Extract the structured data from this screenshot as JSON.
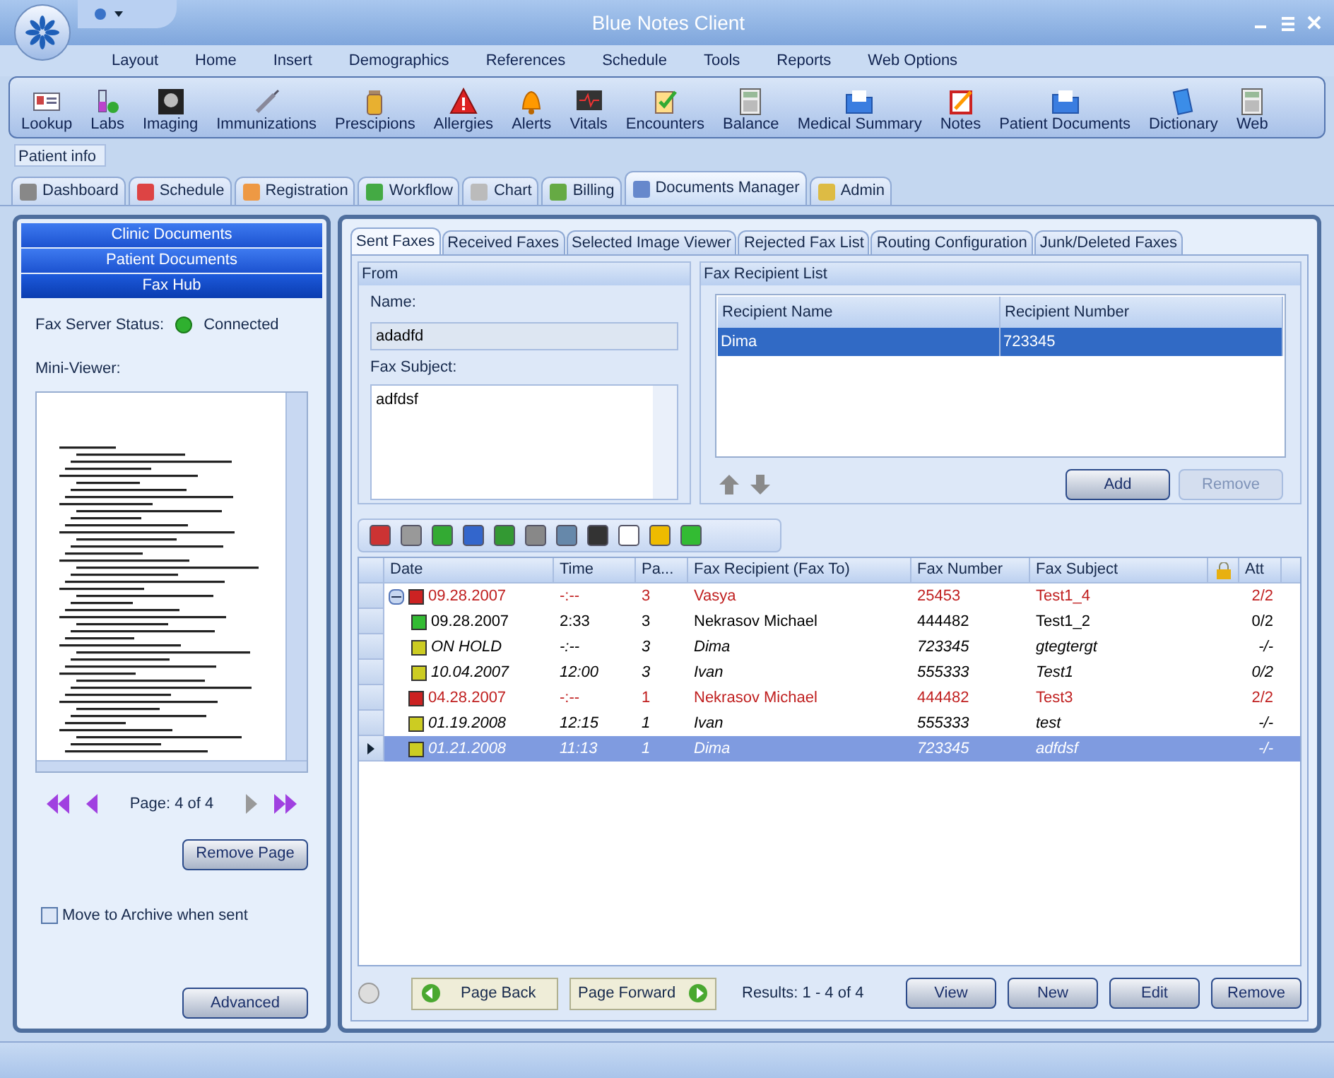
{
  "window": {
    "title": "Blue Notes Client"
  },
  "menu": [
    "Layout",
    "Home",
    "Insert",
    "Demographics",
    "References",
    "Schedule",
    "Tools",
    "Reports",
    "Web Options"
  ],
  "toolbar": [
    "Lookup",
    "Labs",
    "Imaging",
    "Immunizations",
    "Prescipions",
    "Allergies",
    "Alerts",
    "Vitals",
    "Encounters",
    "Balance",
    "Medical Summary",
    "Notes",
    "Patient Documents",
    "Dictionary",
    "Web"
  ],
  "patient_info": "Patient info",
  "main_tabs": [
    {
      "label": "Dashboard",
      "selected": false
    },
    {
      "label": "Schedule",
      "selected": false
    },
    {
      "label": "Registration",
      "selected": false
    },
    {
      "label": "Workflow",
      "selected": false
    },
    {
      "label": "Chart",
      "selected": false
    },
    {
      "label": "Billing",
      "selected": false
    },
    {
      "label": "Documents Manager",
      "selected": true
    },
    {
      "label": "Admin",
      "selected": false
    }
  ],
  "left_panel": {
    "sections": [
      {
        "label": "Clinic Documents",
        "selected": false
      },
      {
        "label": "Patient Documents",
        "selected": false
      },
      {
        "label": "Fax Hub",
        "selected": true
      }
    ],
    "fax_server_label": "Fax Server Status:",
    "fax_server_connected": true,
    "fax_server_status": "Connected",
    "mini_viewer_label": "Mini-Viewer:",
    "page_indicator": "Page: 4 of 4",
    "remove_page": "Remove Page",
    "archive": {
      "label": "Move to Archive when sent",
      "checked": false
    },
    "advanced": "Advanced"
  },
  "fax_tabs": [
    {
      "label": "Sent Faxes",
      "selected": true
    },
    {
      "label": "Received Faxes",
      "selected": false
    },
    {
      "label": "Selected Image Viewer",
      "selected": false
    },
    {
      "label": "Rejected Fax List",
      "selected": false
    },
    {
      "label": "Routing Configuration",
      "selected": false
    },
    {
      "label": "Junk/Deleted Faxes",
      "selected": false
    }
  ],
  "from": {
    "title": "From",
    "name_label": "Name:",
    "name_value": "adadfd",
    "subject_label": "Fax Subject:",
    "subject_value": "adfdsf"
  },
  "recipients": {
    "title": "Fax Recipient List",
    "columns": [
      "Recipient Name",
      "Recipient Number"
    ],
    "rows": [
      {
        "cells": [
          "Dima",
          "723345"
        ],
        "selected": true
      }
    ],
    "add": {
      "label": "Add",
      "disabled": false
    },
    "remove": {
      "label": "Remove",
      "disabled": true
    }
  },
  "grid": {
    "columns": [
      "Date",
      "Time",
      "Pa...",
      "Fax Recipient (Fax To)",
      "Fax Number",
      "Fax Subject",
      "",
      "Att"
    ],
    "rows": [
      {
        "cells": [
          "09.28.2007",
          "-:--",
          "3",
          "Vasya",
          "25453",
          "Test1_4",
          "2/2"
        ],
        "color": "#cc2222",
        "kind": "failed",
        "selected": false,
        "expanded": true,
        "children": [
          {
            "cells": [
              "09.28.2007",
              "2:33",
              "3",
              "Nekrasov Michael",
              "444482",
              "Test1_2",
              "0/2"
            ],
            "color": "#33bb33",
            "kind": "sent",
            "selected": false
          },
          {
            "cells": [
              "ON HOLD",
              "-:--",
              "3",
              "Dima",
              "723345",
              "gtegtergt",
              "-/-"
            ],
            "color": "#cccc22",
            "kind": "pending",
            "selected": false
          },
          {
            "cells": [
              "10.04.2007",
              "12:00",
              "3",
              "Ivan",
              "555333",
              "Test1",
              "0/2"
            ],
            "color": "#cccc22",
            "kind": "pending",
            "selected": false
          }
        ]
      },
      {
        "cells": [
          "04.28.2007",
          "-:--",
          "1",
          "Nekrasov Michael",
          "444482",
          "Test3",
          "2/2"
        ],
        "color": "#cc2222",
        "kind": "failed",
        "selected": false
      },
      {
        "cells": [
          "01.19.2008",
          "12:15",
          "1",
          "Ivan",
          "555333",
          "test",
          "-/-"
        ],
        "color": "#cccc22",
        "kind": "pending",
        "selected": false
      },
      {
        "cells": [
          "01.21.2008",
          "11:13",
          "1",
          "Dima",
          "723345",
          "adfdsf",
          "-/-"
        ],
        "color": "#cccc22",
        "kind": "pending",
        "selected": true
      }
    ]
  },
  "footer": {
    "page_back": "Page Back",
    "page_forward": "Page Forward",
    "results": "Results: 1 - 4 of 4",
    "buttons": [
      "View",
      "New",
      "Edit",
      "Remove"
    ]
  }
}
